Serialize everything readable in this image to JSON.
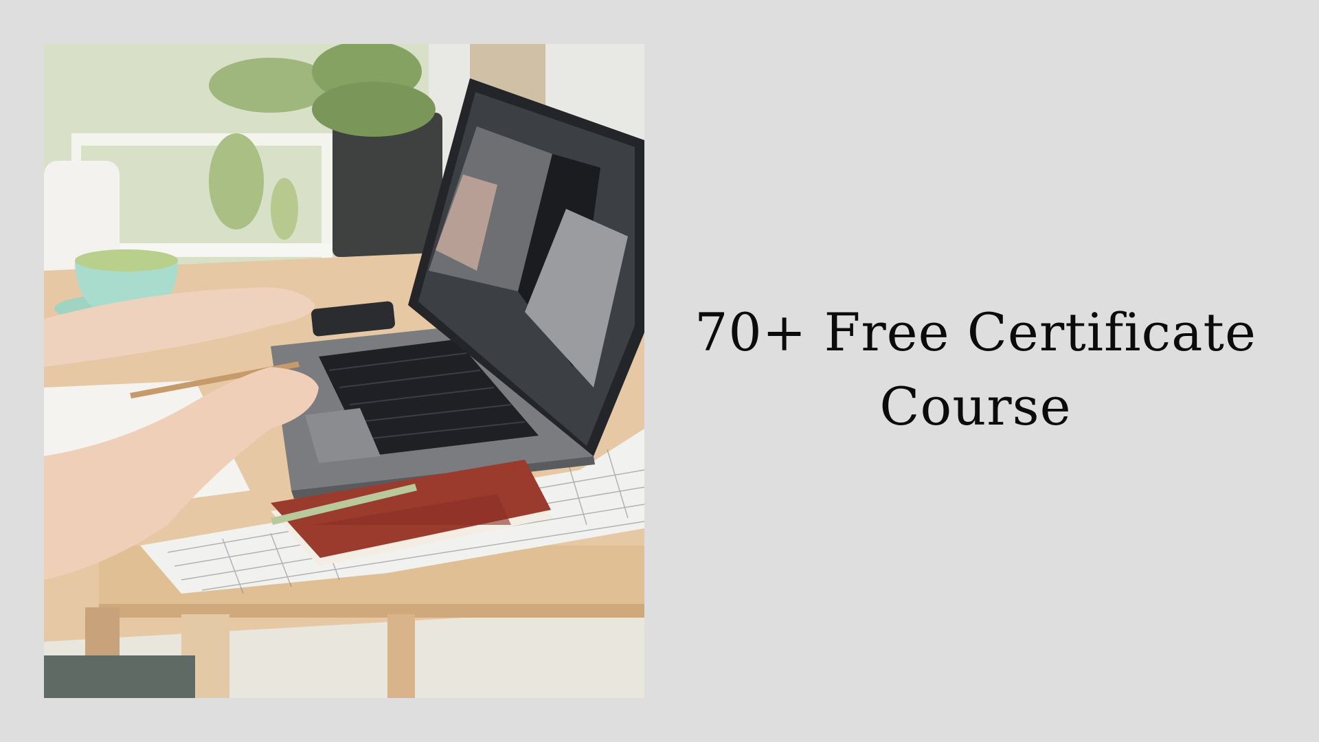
{
  "headline": {
    "line1": "70+ Free Certificate",
    "line2": "Course"
  },
  "photo": {
    "subject": "person-typing-on-laptop",
    "palette": {
      "background": "#dedede",
      "table": "#e3c7a3",
      "wall": "#dfe3d4",
      "plant": "#8fa86a",
      "laptop": "#5d5f63",
      "notebook": "#9b3b2e",
      "mug": "#a9dccc"
    }
  }
}
